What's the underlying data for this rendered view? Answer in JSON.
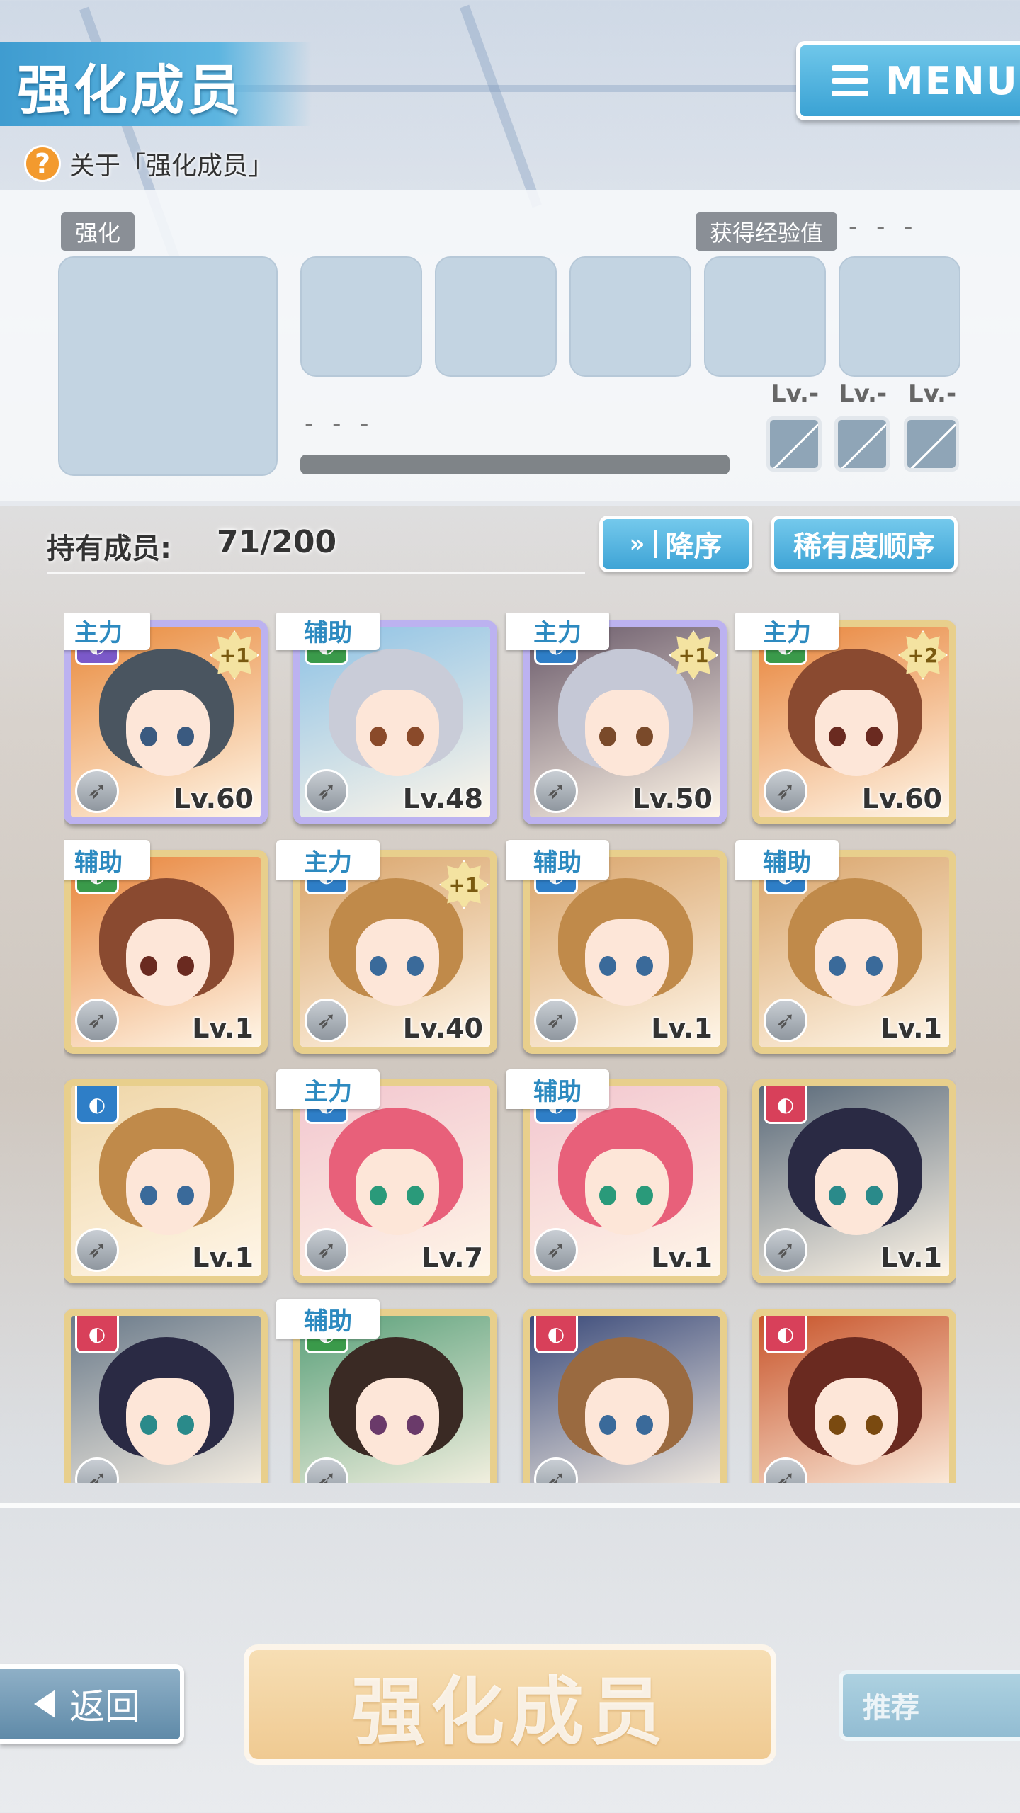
{
  "header": {
    "title": "强化成员",
    "help_text": "关于「强化成员」",
    "help_icon": "?",
    "menu_label": "MENU"
  },
  "enhance_panel": {
    "tag_enhance": "强化",
    "tag_exp": "获得经验值",
    "exp_value": "- - -",
    "exp_bar_value": "- - -",
    "skill_levels": [
      "Lv.-",
      "Lv.-",
      "Lv.-"
    ]
  },
  "members": {
    "owned_label": "持有成员:",
    "owned_count": "71/200",
    "sort_order": "降序",
    "sort_order_icon": "»",
    "sort_by": "稀有度顺序"
  },
  "cards": [
    {
      "role": "主力",
      "plus": "+1",
      "level": "Lv.60",
      "attr_color": "#7b59c9",
      "hair": "#4a5560",
      "eye": "#3a5a80",
      "bg": "#e98a3c",
      "rainbow": true
    },
    {
      "role": "辅助",
      "plus": "",
      "level": "Lv.48",
      "attr_color": "#3a9a4a",
      "hair": "#c9ccd8",
      "eye": "#8a4a2a",
      "bg": "#8ec2e6",
      "rainbow": true
    },
    {
      "role": "主力",
      "plus": "+1",
      "level": "Lv.50",
      "attr_color": "#2e7ec7",
      "hair": "#c5c8d6",
      "eye": "#7a4a2a",
      "bg": "#6a5a6a",
      "rainbow": true
    },
    {
      "role": "主力",
      "plus": "+2",
      "level": "Lv.60",
      "attr_color": "#3a9a4a",
      "hair": "#8a4a30",
      "eye": "#6a2a20",
      "bg": "#e8843a",
      "rainbow": false
    },
    {
      "role": "辅助",
      "plus": "",
      "level": "Lv.1",
      "attr_color": "#3a9a4a",
      "hair": "#8a4a30",
      "eye": "#6a2a20",
      "bg": "#e8843a",
      "rainbow": false
    },
    {
      "role": "主力",
      "plus": "+1",
      "level": "Lv.40",
      "attr_color": "#2e7ec7",
      "hair": "#c08a4a",
      "eye": "#3a6a9a",
      "bg": "#d9a46a",
      "rainbow": false
    },
    {
      "role": "辅助",
      "plus": "",
      "level": "Lv.1",
      "attr_color": "#2e7ec7",
      "hair": "#c08a4a",
      "eye": "#3a6a9a",
      "bg": "#d9a46a",
      "rainbow": false
    },
    {
      "role": "辅助",
      "plus": "",
      "level": "Lv.1",
      "attr_color": "#2e7ec7",
      "hair": "#c08a4a",
      "eye": "#3a6a9a",
      "bg": "#d9a46a",
      "rainbow": false
    },
    {
      "role": "",
      "plus": "",
      "level": "Lv.1",
      "attr_color": "#2e7ec7",
      "hair": "#c08a4a",
      "eye": "#3a6a9a",
      "bg": "#efd6a8",
      "rainbow": false
    },
    {
      "role": "主力",
      "plus": "",
      "level": "Lv.7",
      "attr_color": "#2e7ec7",
      "hair": "#e8607a",
      "eye": "#2a9a7a",
      "bg": "#f2c6cf",
      "rainbow": false
    },
    {
      "role": "辅助",
      "plus": "",
      "level": "Lv.1",
      "attr_color": "#2e7ec7",
      "hair": "#e8607a",
      "eye": "#2a9a7a",
      "bg": "#f2c6cf",
      "rainbow": false
    },
    {
      "role": "",
      "plus": "",
      "level": "Lv.1",
      "attr_color": "#d8405a",
      "hair": "#2a2a44",
      "eye": "#2a8a8a",
      "bg": "#5a6a7a",
      "rainbow": false
    },
    {
      "role": "",
      "plus": "",
      "level": "",
      "attr_color": "#d8405a",
      "hair": "#2a2a44",
      "eye": "#2a8a8a",
      "bg": "#6a7a8a",
      "rainbow": false
    },
    {
      "role": "辅助",
      "plus": "",
      "level": "",
      "attr_color": "#3a9a4a",
      "hair": "#3a2a24",
      "eye": "#6a3a6a",
      "bg": "#5aa07a",
      "rainbow": false
    },
    {
      "role": "",
      "plus": "",
      "level": "",
      "attr_color": "#d8405a",
      "hair": "#9a6a40",
      "eye": "#3a6a9a",
      "bg": "#3a4a7a",
      "rainbow": false
    },
    {
      "role": "",
      "plus": "",
      "level": "",
      "attr_color": "#d8405a",
      "hair": "#6a2a20",
      "eye": "#7a4a10",
      "bg": "#c8542a",
      "rainbow": false
    }
  ],
  "footer": {
    "back_label": "返回",
    "enhance_label": "强化成员",
    "recommend_label": "推荐"
  }
}
